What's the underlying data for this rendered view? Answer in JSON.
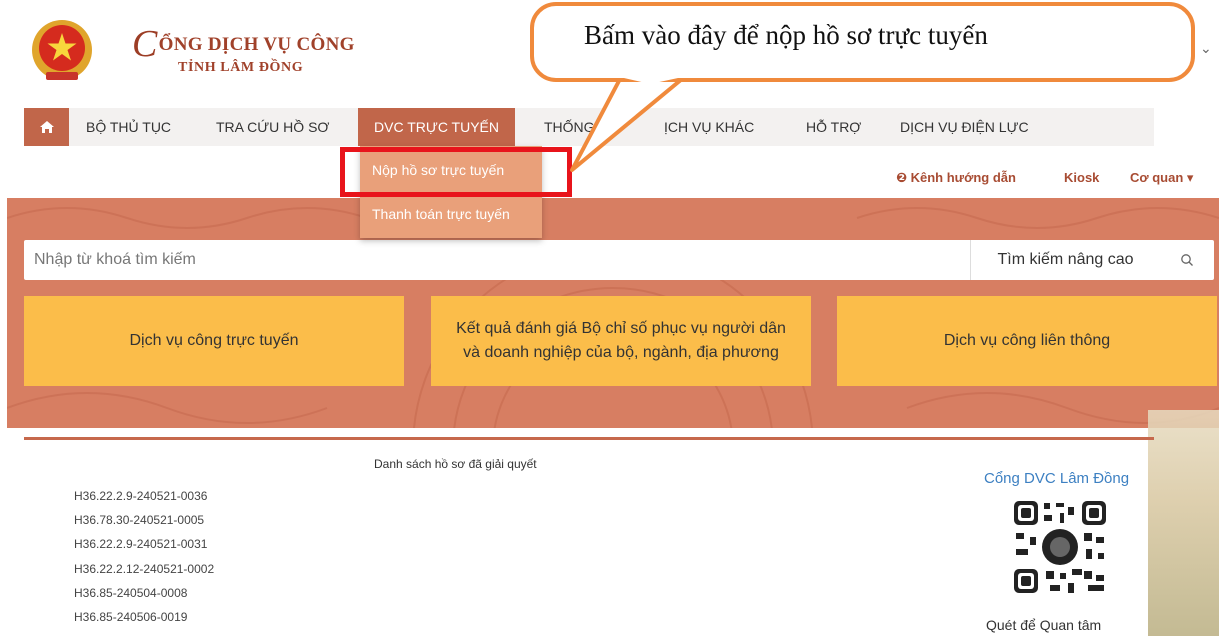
{
  "header": {
    "brand_title": "ỔNG DỊCH VỤ CÔNG",
    "brand_letter": "C",
    "brand_sub": "TỈNH LÂM ĐỒNG"
  },
  "nav": {
    "items": [
      {
        "label": "BỘ THỦ TỤC"
      },
      {
        "label": "TRA CỨU HỒ SƠ"
      },
      {
        "label": "DVC TRỰC TUYẾN"
      },
      {
        "label": "THỐNG"
      },
      {
        "label": "ỊCH VỤ KHÁC"
      },
      {
        "label": "HỖ TRỢ"
      },
      {
        "label": "DỊCH VỤ ĐIỆN LỰC"
      }
    ]
  },
  "dropdown": {
    "items": [
      {
        "label": "Nộp hồ sơ trực tuyến"
      },
      {
        "label": "Thanh toán trực tuyến"
      }
    ]
  },
  "sublinks": {
    "guide": "❷ Kênh hướng dẫn",
    "kiosk": "Kiosk",
    "agency": "Cơ quan ▾"
  },
  "search": {
    "placeholder": "Nhập từ khoá tìm kiếm",
    "advanced": "Tìm kiếm nâng cao"
  },
  "tiles": [
    {
      "label": "Dịch vụ công trực tuyến"
    },
    {
      "label": "Kết quả đánh giá Bộ chỉ số phục vụ người dân và doanh nghiệp của bộ, ngành, địa phương"
    },
    {
      "label": "Dịch vụ công liên thông"
    }
  ],
  "records": {
    "title": "Danh sách hồ sơ đã giải quyết",
    "items": [
      "H36.22.2.9-240521-0036",
      "H36.78.30-240521-0005",
      "H36.22.2.9-240521-0031",
      "H36.22.2.12-240521-0002",
      "H36.85-240504-0008",
      "H36.85-240506-0019"
    ]
  },
  "qr": {
    "title": "Cổng DVC Lâm Đồng",
    "caption": "Quét để Quan tâm"
  },
  "callout": {
    "text": "Bấm vào đây để nộp hồ sơ trực tuyến"
  },
  "colors": {
    "primary": "#c1664a",
    "banner": "#d77e62",
    "tile": "#fbbd4a",
    "highlight": "#e8141b",
    "callout_border": "#f08a3c"
  }
}
